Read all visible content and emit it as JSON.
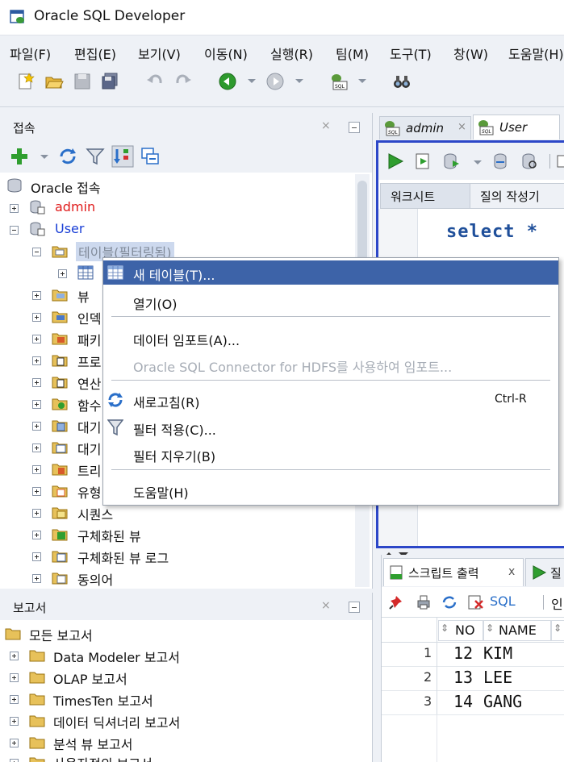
{
  "window": {
    "title": "Oracle SQL Developer"
  },
  "menubar": {
    "items": [
      "파일(F)",
      "편집(E)",
      "보기(V)",
      "이동(N)",
      "실행(R)",
      "팀(M)",
      "도구(T)",
      "창(W)",
      "도움말(H)"
    ]
  },
  "toolbar": {
    "icons": [
      "new-icon",
      "open-icon",
      "save-icon",
      "save-all-icon",
      "undo-icon",
      "redo-icon",
      "back-icon",
      "forward-icon",
      "sql-icon",
      "binoculars-icon"
    ]
  },
  "connections_panel": {
    "title": "접속",
    "root": "Oracle 접속",
    "connections": [
      {
        "label": "admin",
        "color": "#e01b1b"
      },
      {
        "label": "User",
        "color": "#1a3fd6"
      }
    ],
    "tables_node": "테이블(필터링됨)",
    "nodes": [
      "뷰",
      "인덱",
      "패키",
      "프로",
      "연산",
      "함수",
      "대기",
      "대기",
      "트리",
      "유형",
      "시퀀스",
      "구체화된 뷰",
      "구체화된 뷰 로그",
      "동의어"
    ]
  },
  "reports_panel": {
    "title": "보고서",
    "root": "모든 보고서",
    "items": [
      "Data Modeler 보고서",
      "OLAP 보고서",
      "TimesTen 보고서",
      "데이터 딕셔너리 보고서",
      "분석 뷰 보고서",
      "사용자정의 보고서"
    ]
  },
  "editor": {
    "tabs": [
      "admin",
      "User"
    ],
    "subtabs": [
      "워크시트",
      "질의 작성기"
    ],
    "sql_text": "select *"
  },
  "output": {
    "tabs": [
      "스크립트 출력",
      "질"
    ],
    "toolbar_sql": "SQL",
    "toolbar_suffix": "인",
    "columns": [
      "NO",
      "NAME"
    ],
    "rows": [
      {
        "row": "1",
        "no": "12",
        "name": "KIM"
      },
      {
        "row": "2",
        "no": "13",
        "name": "LEE"
      },
      {
        "row": "3",
        "no": "14",
        "name": "GANG"
      }
    ]
  },
  "context_menu": {
    "new_table": "새 테이블(T)...",
    "open": "열기(O)",
    "import_data": "데이터 임포트(A)...",
    "hdfs_import": "Oracle SQL Connector for HDFS를 사용하여 임포트...",
    "refresh": "새로고침(R)",
    "refresh_shortcut": "Ctrl-R",
    "apply_filter": "필터 적용(C)...",
    "clear_filter": "필터 지우기(B)",
    "help": "도움말(H)"
  },
  "colors": {
    "selection": "#3d63a8",
    "accent_blue": "#2c47c8"
  }
}
